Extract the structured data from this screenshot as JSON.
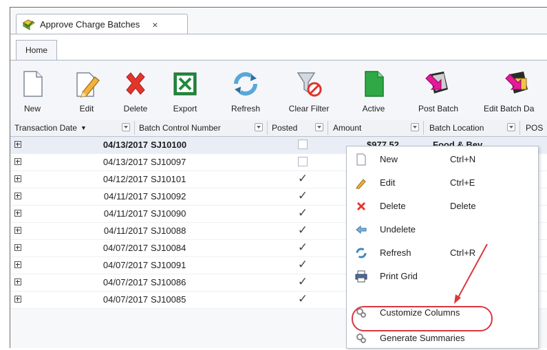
{
  "window": {
    "doc_tab_title": "Approve Charge Batches",
    "doc_tab_close": "×",
    "ribbon_tab": "Home"
  },
  "ribbon": {
    "buttons": [
      {
        "label": "New",
        "icon": "new-document-icon"
      },
      {
        "label": "Edit",
        "icon": "edit-pencil-icon"
      },
      {
        "label": "Delete",
        "icon": "delete-x-icon"
      },
      {
        "label": "Export",
        "icon": "excel-export-icon"
      },
      {
        "label": "Refresh",
        "icon": "refresh-icon"
      },
      {
        "label": "Clear Filter",
        "icon": "clear-filter-icon"
      },
      {
        "label": "Active",
        "icon": "active-document-icon"
      },
      {
        "label": "Post Batch",
        "icon": "post-batch-icon"
      },
      {
        "label": "Edit Batch Da",
        "icon": "edit-batch-date-icon"
      }
    ]
  },
  "grid": {
    "columns": {
      "transaction_date": "Transaction Date",
      "sort_indicator": "▼",
      "batch_control_number": "Batch Control Number",
      "posted": "Posted",
      "amount": "Amount",
      "batch_location": "Batch Location",
      "pos": "POS"
    },
    "rows": [
      {
        "date": "04/13/2017",
        "batch": "SJ10100",
        "posted": false,
        "amount": "$977.52",
        "location": "Food & Bev"
      },
      {
        "date": "04/13/2017",
        "batch": "SJ10097",
        "posted": false,
        "amount": "",
        "location": ""
      },
      {
        "date": "04/12/2017",
        "batch": "SJ10101",
        "posted": true,
        "amount": "",
        "location": ""
      },
      {
        "date": "04/11/2017",
        "batch": "SJ10092",
        "posted": true,
        "amount": "",
        "location": ""
      },
      {
        "date": "04/11/2017",
        "batch": "SJ10090",
        "posted": true,
        "amount": "",
        "location": ""
      },
      {
        "date": "04/11/2017",
        "batch": "SJ10088",
        "posted": true,
        "amount": "",
        "location": ""
      },
      {
        "date": "04/07/2017",
        "batch": "SJ10084",
        "posted": true,
        "amount": "",
        "location": ""
      },
      {
        "date": "04/07/2017",
        "batch": "SJ10091",
        "posted": true,
        "amount": "",
        "location": ""
      },
      {
        "date": "04/07/2017",
        "batch": "SJ10086",
        "posted": true,
        "amount": "",
        "location": ""
      },
      {
        "date": "04/07/2017",
        "batch": "SJ10085",
        "posted": true,
        "amount": "",
        "location": ""
      }
    ]
  },
  "context_menu": {
    "items": [
      {
        "label": "New",
        "shortcut": "Ctrl+N",
        "icon": "new-icon"
      },
      {
        "label": "Edit",
        "shortcut": "Ctrl+E",
        "icon": "edit-icon"
      },
      {
        "label": "Delete",
        "shortcut": "Delete",
        "icon": "delete-icon"
      },
      {
        "label": "Undelete",
        "shortcut": "",
        "icon": "undelete-icon"
      },
      {
        "label": "Refresh",
        "shortcut": "Ctrl+R",
        "icon": "refresh-icon"
      },
      {
        "label": "Print Grid",
        "shortcut": "",
        "icon": "print-icon"
      },
      {
        "label": "Customize Columns",
        "shortcut": "",
        "icon": "customize-columns-icon"
      },
      {
        "label": "Generate Summaries",
        "shortcut": "",
        "icon": "generate-summaries-icon"
      }
    ]
  },
  "annotation": {
    "color": "#d9363e"
  }
}
